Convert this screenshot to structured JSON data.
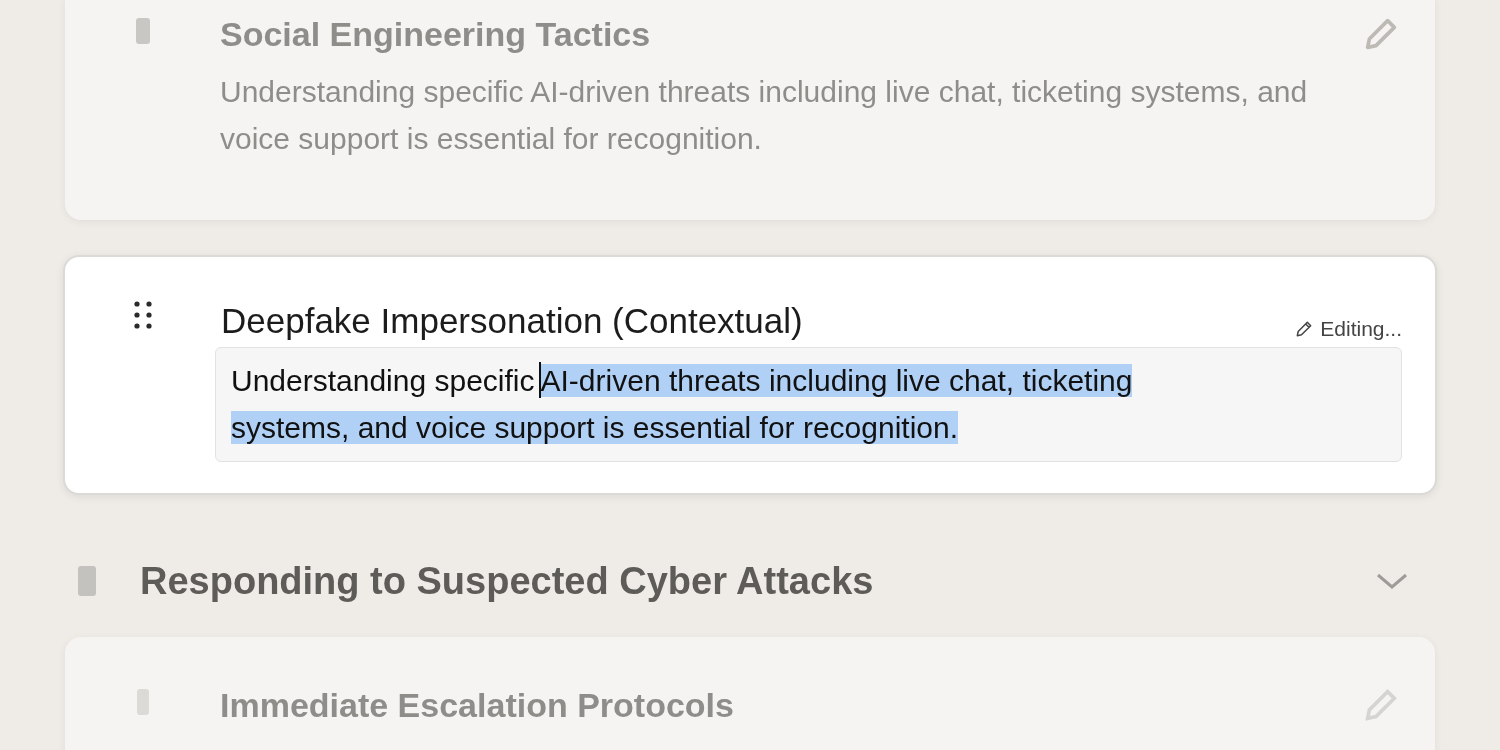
{
  "lessons_above": [
    {
      "title": "Social Engineering Tactics",
      "description": "Understanding specific AI-driven threats including live chat, ticketing systems, and voice support is essential for recognition."
    }
  ],
  "editing_lesson": {
    "title": "Deepfake Impersonation (Contextual)",
    "status": "Editing...",
    "value_before_cursor": "Understanding specific",
    "value_selected": "AI-driven threats including live chat, ticketing systems, and voice support is essential for recognition."
  },
  "section": {
    "title": "Responding to Suspected Cyber Attacks",
    "expanded": true,
    "lessons": [
      {
        "title": "Immediate Escalation Protocols"
      }
    ]
  }
}
